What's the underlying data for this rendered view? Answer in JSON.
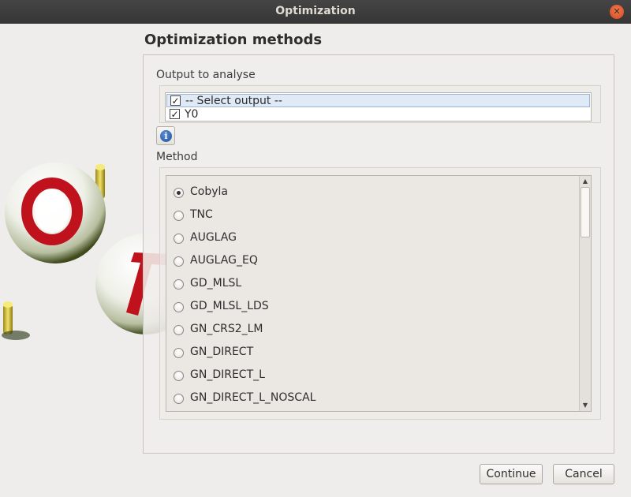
{
  "window": {
    "title": "Optimization"
  },
  "heading": "Optimization methods",
  "output_section": {
    "label": "Output to analyse",
    "items": [
      {
        "label": "-- Select output --",
        "checked": true,
        "selected": true
      },
      {
        "label": "Y0",
        "checked": true,
        "selected": false
      }
    ]
  },
  "method_section": {
    "label": "Method",
    "selected": "Cobyla",
    "options": [
      "Cobyla",
      "TNC",
      "AUGLAG",
      "AUGLAG_EQ",
      "GD_MLSL",
      "GD_MLSL_LDS",
      "GN_CRS2_LM",
      "GN_DIRECT",
      "GN_DIRECT_L",
      "GN_DIRECT_L_NOSCAL"
    ]
  },
  "buttons": {
    "continue": "Continue",
    "cancel": "Cancel"
  },
  "icons": {
    "close": "close-icon",
    "info": "info-icon",
    "check": "✓"
  }
}
